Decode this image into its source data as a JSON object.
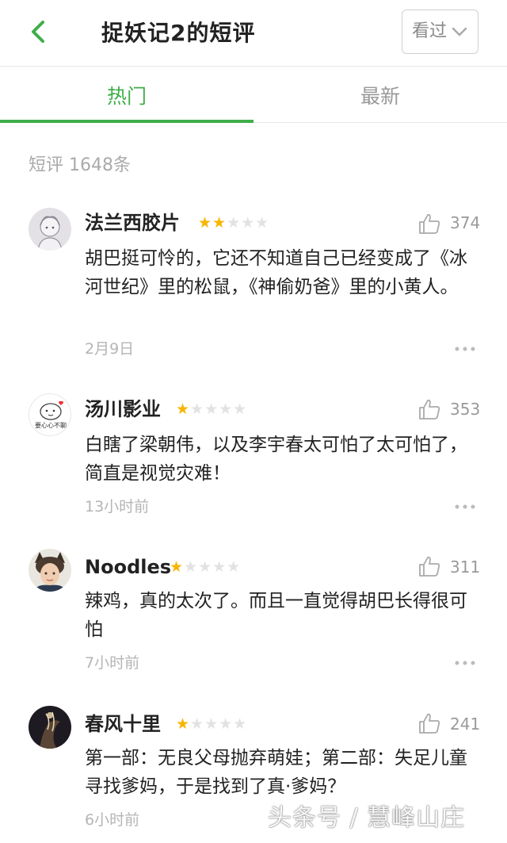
{
  "header": {
    "title": "捉妖记2的短评",
    "watched_label": "看过"
  },
  "tabs": [
    {
      "label": "热门"
    },
    {
      "label": "最新"
    }
  ],
  "count_text": "短评 1648条",
  "comments": [
    {
      "user": "法兰西胶片",
      "rating": 2,
      "likes": "374",
      "text": "胡巴挺可怜的，它还不知道自己已经变成了《冰河世纪》里的松鼠，《神偷奶爸》里的小黄人。",
      "date": "2月9日"
    },
    {
      "user": "汤川影业",
      "rating": 1,
      "likes": "353",
      "text": "白瞎了梁朝伟，以及李宇春太可怕了太可怕了，简直是视觉灾难！",
      "date": "13小时前",
      "avatar_text": "要心心不聊"
    },
    {
      "user": "Noodles",
      "rating": 1,
      "likes": "311",
      "text": "辣鸡，真的太次了。而且一直觉得胡巴长得很可怕",
      "date": "7小时前"
    },
    {
      "user": "春风十里",
      "rating": 1,
      "likes": "241",
      "text": "第一部：无良父母抛弃萌娃；第二部：失足儿童寻找爹妈，于是找到了真·爹妈？",
      "date": "6小时前"
    }
  ],
  "watermark": "头条号 / 慧峰山庄",
  "colors": {
    "accent": "#3fae49",
    "star": "#f7b500",
    "star_empty": "#e2e2e2"
  }
}
